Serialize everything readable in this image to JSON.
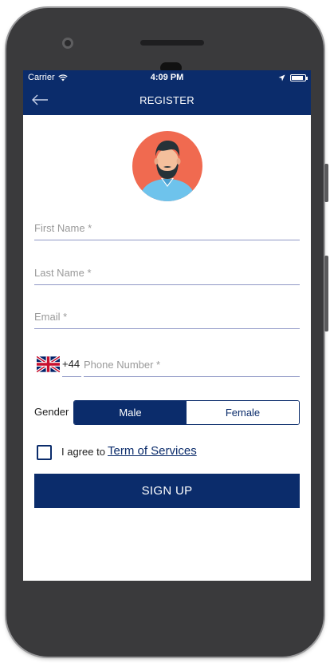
{
  "status_bar": {
    "carrier": "Carrier",
    "time": "4:09 PM",
    "battery_level": 0.85
  },
  "header": {
    "title": "REGISTER"
  },
  "form": {
    "first_name_placeholder": "First Name *",
    "last_name_placeholder": "Last Name *",
    "email_placeholder": "Email *",
    "country_code": "+44",
    "phone_placeholder": "Phone Number *"
  },
  "gender": {
    "label": "Gender",
    "options": [
      "Male",
      "Female"
    ],
    "selected": "Male"
  },
  "agreement": {
    "prefix": "I agree to",
    "link_text": "Term of Services",
    "checked": false
  },
  "signup_label": "SIGN UP",
  "colors": {
    "primary": "#0b2c6b",
    "underline": "#9098c6",
    "avatar_bg": "#f06a50"
  },
  "icons": {
    "back": "arrow-left-icon",
    "wifi": "wifi-icon",
    "location": "location-arrow-icon",
    "battery": "battery-icon",
    "flag": "uk-flag-icon",
    "avatar": "user-avatar-icon"
  }
}
